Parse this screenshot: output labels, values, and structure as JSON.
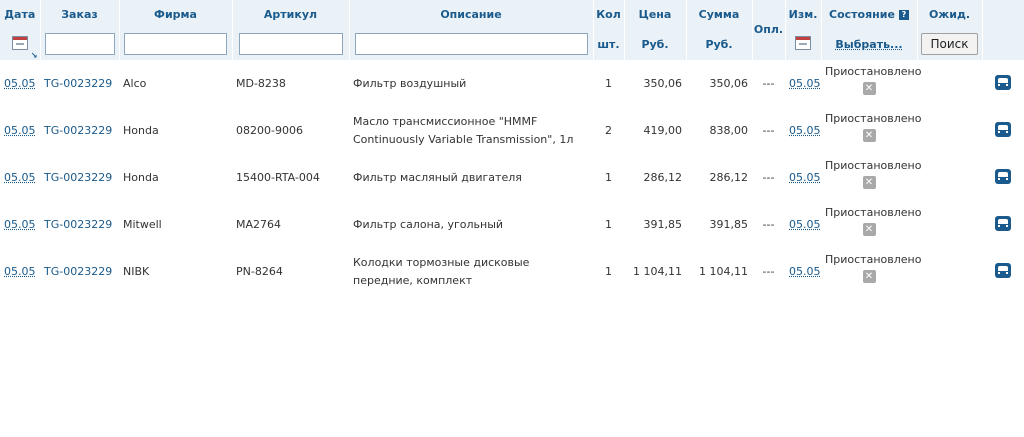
{
  "headers": {
    "date": "Дата",
    "order": "Заказ",
    "firm": "Фирма",
    "article": "Артикул",
    "description": "Описание",
    "qty": "Кол",
    "qty_unit": "шт.",
    "price": "Цена",
    "price_unit": "Руб.",
    "sum": "Сумма",
    "sum_unit": "Руб.",
    "paid": "Опл.",
    "changed": "Изм.",
    "state": "Состояние",
    "state_help_glyph": "?",
    "choose_label": "Выбрать...",
    "waiting": "Ожид.",
    "search_button": "Поиск"
  },
  "filters": {
    "order": "",
    "firm": "",
    "article": "",
    "description": ""
  },
  "rows": [
    {
      "date": "05.05",
      "order": "TG-0023229",
      "firm": "Alco",
      "article": "MD-8238",
      "description": "Фильтр воздушный",
      "qty": "1",
      "price": "350,06",
      "sum": "350,06",
      "paid": "---",
      "changed": "05.05",
      "state": "Приостановлено"
    },
    {
      "date": "05.05",
      "order": "TG-0023229",
      "firm": "Honda",
      "article": "08200-9006",
      "description": "Масло трансмиссионное \"HMMF Continuously Variable Transmission\", 1л",
      "qty": "2",
      "price": "419,00",
      "sum": "838,00",
      "paid": "---",
      "changed": "05.05",
      "state": "Приостановлено"
    },
    {
      "date": "05.05",
      "order": "TG-0023229",
      "firm": "Honda",
      "article": "15400-RTA-004",
      "description": "Фильтр масляный двигателя",
      "qty": "1",
      "price": "286,12",
      "sum": "286,12",
      "paid": "---",
      "changed": "05.05",
      "state": "Приостановлено"
    },
    {
      "date": "05.05",
      "order": "TG-0023229",
      "firm": "Mitwell",
      "article": "MA2764",
      "description": "Фильтр салона, угольный",
      "qty": "1",
      "price": "391,85",
      "sum": "391,85",
      "paid": "---",
      "changed": "05.05",
      "state": "Приостановлено"
    },
    {
      "date": "05.05",
      "order": "TG-0023229",
      "firm": "NIBK",
      "article": "PN-8264",
      "description": "Колодки тормозные дисковые передние, комплект",
      "qty": "1",
      "price": "1 104,11",
      "sum": "1 104,11",
      "paid": "---",
      "changed": "05.05",
      "state": "Приостановлено"
    }
  ],
  "icons": {
    "calendar": "calendar-icon",
    "cancel": "cancel-icon",
    "car": "car-icon",
    "sort": "sort-arrow-icon",
    "help": "help-icon"
  },
  "glyphs": {
    "cancel": "✕",
    "sort": "↘"
  },
  "colors": {
    "header_bg": "#eaf2f8",
    "header_text": "#1a5a8c",
    "link": "#1a5a8c",
    "cancel_bg": "#a9a9a9"
  }
}
